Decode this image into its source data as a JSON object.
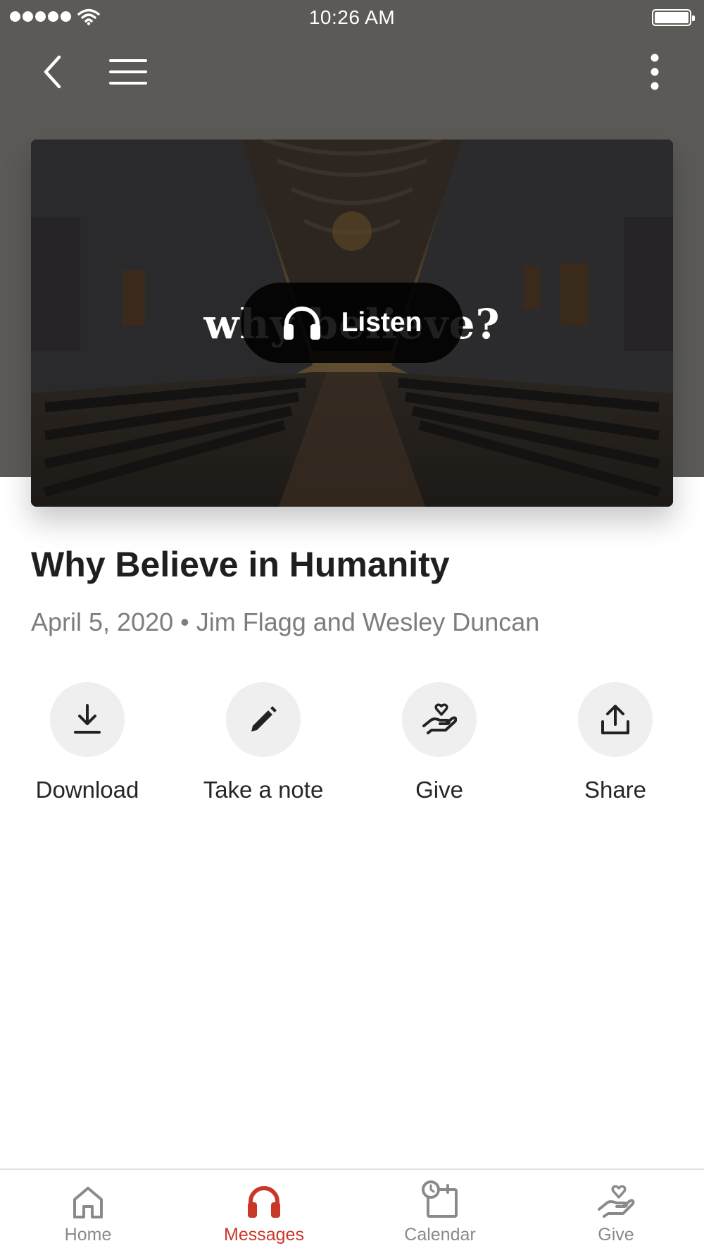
{
  "status_bar": {
    "time": "10:26 AM"
  },
  "hero": {
    "title_text": "why believe?",
    "listen_label": "Listen"
  },
  "message": {
    "title": "Why Believe in Humanity",
    "meta": "April 5, 2020 • Jim Flagg and Wesley Duncan"
  },
  "actions": [
    {
      "label": "Download",
      "icon": "download-icon"
    },
    {
      "label": "Take a note",
      "icon": "pencil-icon"
    },
    {
      "label": "Give",
      "icon": "heart-hand-icon"
    },
    {
      "label": "Share",
      "icon": "share-icon"
    }
  ],
  "tabs": [
    {
      "label": "Home",
      "icon": "home-icon",
      "active": false
    },
    {
      "label": "Messages",
      "icon": "headphones-icon",
      "active": true
    },
    {
      "label": "Calendar",
      "icon": "calendar-icon",
      "active": false
    },
    {
      "label": "Give",
      "icon": "heart-hand-icon",
      "active": false
    }
  ],
  "colors": {
    "header_bg": "#5b5a57",
    "accent": "#c8382a",
    "action_circle": "#efefef",
    "tab_inactive": "#8a8a8a"
  }
}
